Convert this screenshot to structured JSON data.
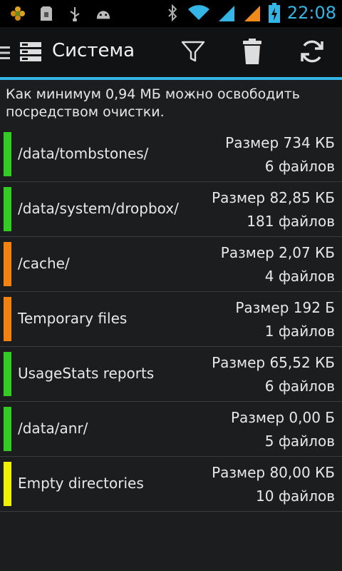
{
  "status_bar": {
    "time": "22:08",
    "icons": [
      "flower-notification-icon",
      "sd-card-icon",
      "usb-icon",
      "android-debug-icon",
      "bluetooth-icon",
      "wifi-icon",
      "signal-icon",
      "signal-icon-2",
      "battery-charging-icon"
    ]
  },
  "action_bar": {
    "title": "Система",
    "actions": [
      "filter-icon",
      "trash-icon",
      "refresh-icon"
    ]
  },
  "summary_text": "Как минимум 0,94 МБ можно освободить посредством очистки.",
  "colors": {
    "accent": "#33b5e5",
    "green": "#2ecc2a",
    "orange": "#f5820d",
    "yellow": "#f0f000"
  },
  "items": [
    {
      "path": "/data/tombstones/",
      "size": "Размер 734 КБ",
      "count": "6 файлов",
      "color": "#33cc22"
    },
    {
      "path": "/data/system/dropbox/",
      "size": "Размер 82,85 КБ",
      "count": "181 файлов",
      "color": "#33cc22"
    },
    {
      "path": "/cache/",
      "size": "Размер 2,07 КБ",
      "count": "4 файлов",
      "color": "#f5820d"
    },
    {
      "path": "Temporary files",
      "size": "Размер 192 Б",
      "count": "1 файлов",
      "color": "#f5820d"
    },
    {
      "path": "UsageStats reports",
      "size": "Размер 65,52 КБ",
      "count": "6 файлов",
      "color": "#33cc22"
    },
    {
      "path": "/data/anr/",
      "size": "Размер 0,00 Б",
      "count": "5 файлов",
      "color": "#33cc22"
    },
    {
      "path": "Empty directories",
      "size": "Размер 80,00 КБ",
      "count": "10 файлов",
      "color": "#f0f000"
    }
  ]
}
